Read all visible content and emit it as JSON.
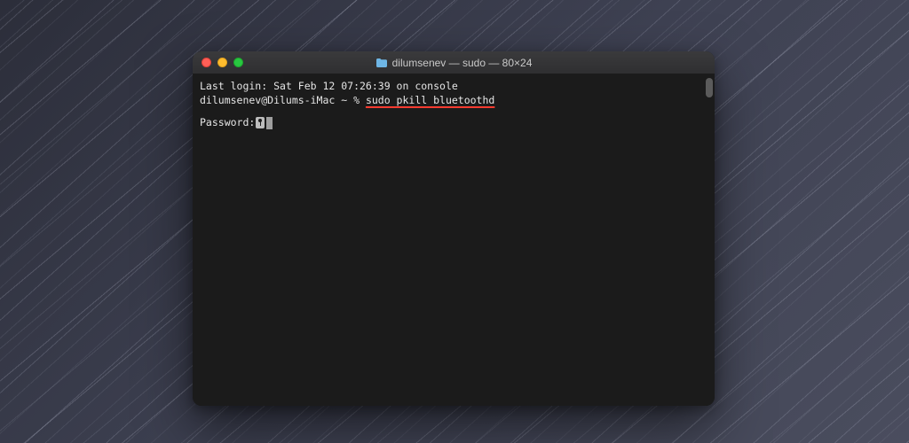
{
  "window": {
    "title": "dilumsenev — sudo — 80×24",
    "folder_icon": "folder-icon"
  },
  "terminal": {
    "last_login": "Last login: Sat Feb 12 07:26:39 on console",
    "prompt": "dilumsenev@Dilums-iMac ~ % ",
    "command": "sudo pkill bluetoothd",
    "password_label": "Password:"
  },
  "colors": {
    "underline": "#ff3b30",
    "bg": "#1b1b1b"
  }
}
